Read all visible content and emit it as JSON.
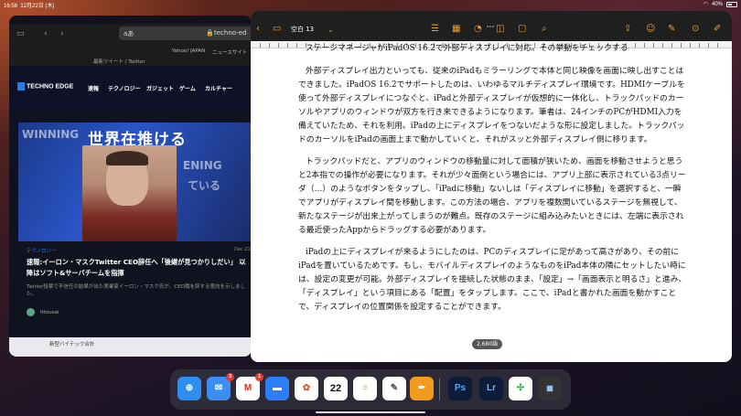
{
  "status_bar": {
    "time": "16:56",
    "date": "12月22日 (木)",
    "battery": "40%"
  },
  "safari": {
    "address": "aあ",
    "url": "techno-ed",
    "favorites": [
      "Yahoo! JAPAN",
      "ニュースサイト"
    ],
    "tweet_bar": "最新ツイート / Twitter",
    "site": {
      "logo": "TECHNO EDGE",
      "nav": [
        "速報",
        "テクノロジー",
        "ガジェット",
        "ゲーム",
        "カルチャー"
      ],
      "hero_title": "世界在推ける",
      "hero_sub": [
        "WINNING",
        "ENING",
        "ている"
      ],
      "category": "テクノロジー",
      "date": "Dec 21",
      "title": "速報:イーロン・マスクTwitter CEO辞任へ「後継が見つかりしだい」 以降はソフト&サーバチームを指揮",
      "desc": "Twitter投票で不信任の結果が出た実業家イーロン・マスク氏が、CEO職を辞する意向を示しました。",
      "author": "Ittousai",
      "next": "新型バイテック合計"
    }
  },
  "pages": {
    "doc_title": "空白 13",
    "char_count": "2,680語",
    "paragraphs": [
      "ステージマネージャがiPadOS 16.2で外部ディスプレイに対応。その挙動をチェックする",
      "外部ディスプレイ出力といっても、従来のiPadもミラーリングで本体と同じ映像を画面に映し出すことはできました。iPadOS 16.2でサポートしたのは、いわゆるマルチディスプレイ環境です。HDMIケーブルを使って外部ディスプレイにつなぐと、iPadと外部ディスプレイが仮想的に一体化し、トラックパッドのカーソルやアプリのウィンドウが双方を行き来できるようになります。筆者は、24インチのPCがHDMI入力を備えていたため、それを利用。iPadの上にディスプレイをつないだような形に設定しました。トラックパッドのカーソルをiPadの画面上まで動かしていくと、それがスッと外部ディスプレイ側に移ります。",
      "トラックパッドだと、アプリのウィンドウの移動量に対して面積が狭いため、画面を移動させようと思うと2本指での操作が必要になります。それが少々面倒という場合には、アプリ上部に表示されている3点リーダ（…）のようなボタンをタップし、「iPadに移動」ないしは「ディスプレイに移動」を選択すると、一瞬でアプリがディスプレイ間を移動します。この方法の場合、アプリを複数開いているステージを無視して、新たなステージが出来上がってしまうのが難点。既存のステージに組み込みたいときには、左端に表示される最近使ったAppからドラッグする必要があります。",
      "iPadの上にディスプレイが来るようにしたのは、PCのディスプレイに足があって高さがあり、その前にiPadを置いているためです。もし、モバイルディスプレイのようなものをiPad本体の隣にセットしたい時には、設定の変更が可能。外部ディスプレイを接続した状態のまま、「設定」→「画面表示と明るさ」と進み、「ディスプレイ」という項目にある「配置」をタップします。ここで、iPadと書かれた画面を動かすことで、ディスプレイの位置関係を設定することができます。"
    ]
  },
  "dock": {
    "apps": [
      {
        "name": "Safari",
        "label": "",
        "color": "#2f8ff0"
      },
      {
        "name": "Mail",
        "label": "✉",
        "color": "#3a8ef6",
        "badge": "3"
      },
      {
        "name": "Gmail",
        "label": "M",
        "color": "#ffffff",
        "badge": "1"
      },
      {
        "name": "Files",
        "label": "",
        "color": "#2d7ff9"
      },
      {
        "name": "Photos",
        "label": "",
        "color": "#ffffff"
      },
      {
        "name": "Calendar",
        "label": "22",
        "color": "#ffffff"
      },
      {
        "name": "Notes",
        "label": "",
        "color": "#ffffff"
      },
      {
        "name": "Goodnotes",
        "label": "",
        "color": "#ffffff"
      },
      {
        "name": "Pages",
        "label": "",
        "color": "#f29b1d"
      },
      {
        "name": "Photoshop",
        "label": "Ps",
        "color": "#0d1c38"
      },
      {
        "name": "Lightroom",
        "label": "Lr",
        "color": "#0d1c38"
      },
      {
        "name": "Photos Google",
        "label": "",
        "color": "#ffffff"
      },
      {
        "name": "Recent",
        "label": "",
        "color": "#333"
      }
    ]
  },
  "colors": {
    "pages_accent": "#e8a13a",
    "safari_accent": "#2a7de1"
  }
}
